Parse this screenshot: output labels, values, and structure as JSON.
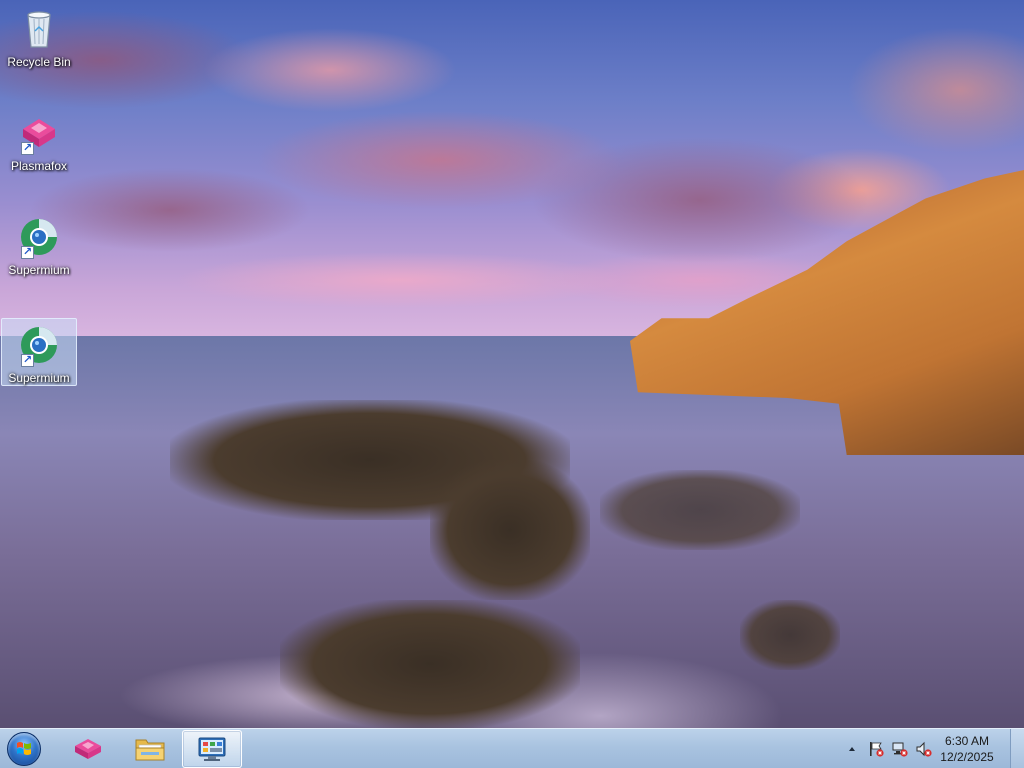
{
  "desktop": {
    "icons": [
      {
        "label": "Recycle Bin",
        "icon": "recycle-bin-icon",
        "selected": false
      },
      {
        "label": "Plasmafox",
        "icon": "plasmafox-icon",
        "selected": false
      },
      {
        "label": "Supermium",
        "icon": "supermium-icon",
        "selected": false
      },
      {
        "label": "Supermium",
        "icon": "supermium-icon",
        "selected": true
      }
    ]
  },
  "taskbar": {
    "start_icon": "windows-logo-icon",
    "pinned": [
      {
        "icon": "plasmafox-icon",
        "active": false
      },
      {
        "icon": "file-explorer-icon",
        "active": false
      },
      {
        "icon": "control-panel-icon",
        "active": true
      }
    ],
    "tray": {
      "show_hidden_icon": "chevron-up-icon",
      "icons": [
        "action-center-flag-icon",
        "network-disconnected-icon",
        "volume-muted-icon"
      ],
      "time": "6:30 AM",
      "date": "12/2/2025"
    }
  },
  "colors": {
    "taskbar_top": "#bcd2ea",
    "taskbar_bottom": "#9cb8d8",
    "selection": "#c8dcf5",
    "start_orb": "#2f74c9",
    "plasmafox_accent": "#e0388f"
  }
}
